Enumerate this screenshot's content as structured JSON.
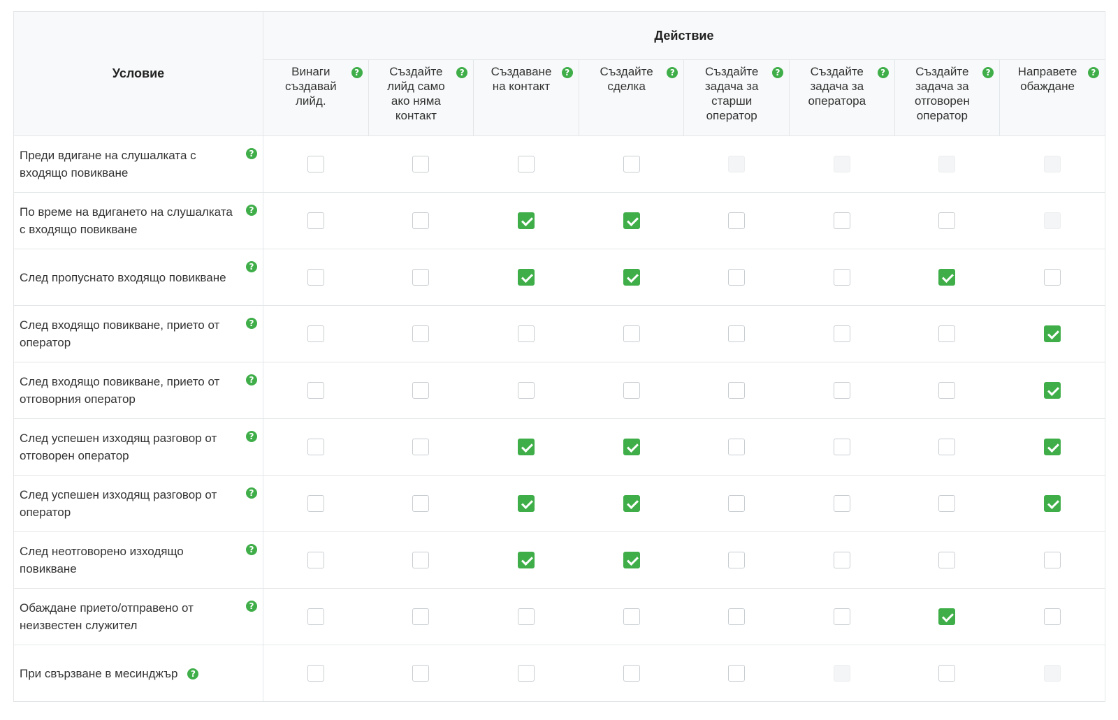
{
  "colors": {
    "accent": "#3fae49",
    "border": "#e3e6e8",
    "header_bg": "#f8f9fa"
  },
  "header": {
    "condition": "Условие",
    "action": "Действие",
    "columns": [
      "Винаги създавай лийд.",
      "Създайте лийд само ако няма контакт",
      "Създаване на контакт",
      "Създайте сделка",
      "Създайте задача за старши оператор",
      "Създайте задача за оператора",
      "Създайте задача за отговорен оператор",
      "Направете обаждане"
    ]
  },
  "help_icon": "?",
  "rows": [
    {
      "label": "Преди вдигане на слушалката с входящо повикване",
      "states": [
        "unchecked",
        "unchecked",
        "unchecked",
        "unchecked",
        "disabled",
        "disabled",
        "disabled",
        "disabled"
      ]
    },
    {
      "label": "По време на вдигането на слушалката с входящо повикване",
      "states": [
        "unchecked",
        "unchecked",
        "checked",
        "checked",
        "unchecked",
        "unchecked",
        "unchecked",
        "disabled"
      ]
    },
    {
      "label": "След пропуснато входящо повикване",
      "states": [
        "unchecked",
        "unchecked",
        "checked",
        "checked",
        "unchecked",
        "unchecked",
        "checked",
        "unchecked"
      ]
    },
    {
      "label": "След входящо повикване, прието от оператор",
      "states": [
        "unchecked",
        "unchecked",
        "unchecked",
        "unchecked",
        "unchecked",
        "unchecked",
        "unchecked",
        "checked"
      ]
    },
    {
      "label": "След входящо повикване, прието от отговорния оператор",
      "states": [
        "unchecked",
        "unchecked",
        "unchecked",
        "unchecked",
        "unchecked",
        "unchecked",
        "unchecked",
        "checked"
      ]
    },
    {
      "label": "След успешен изходящ разговор от отговорен оператор",
      "states": [
        "unchecked",
        "unchecked",
        "checked",
        "checked",
        "unchecked",
        "unchecked",
        "unchecked",
        "checked"
      ]
    },
    {
      "label": "След успешен изходящ разговор от оператор",
      "states": [
        "unchecked",
        "unchecked",
        "checked",
        "checked",
        "unchecked",
        "unchecked",
        "unchecked",
        "checked"
      ]
    },
    {
      "label": "След неотговорено изходящо повикване",
      "states": [
        "unchecked",
        "unchecked",
        "checked",
        "checked",
        "unchecked",
        "unchecked",
        "unchecked",
        "unchecked"
      ]
    },
    {
      "label": "Обаждане прието/отправено от неизвестен служител",
      "states": [
        "unchecked",
        "unchecked",
        "unchecked",
        "unchecked",
        "unchecked",
        "unchecked",
        "checked",
        "unchecked"
      ]
    },
    {
      "label": "При свързване в месинджър",
      "states": [
        "unchecked",
        "unchecked",
        "unchecked",
        "unchecked",
        "unchecked",
        "disabled",
        "unchecked",
        "disabled"
      ]
    }
  ]
}
